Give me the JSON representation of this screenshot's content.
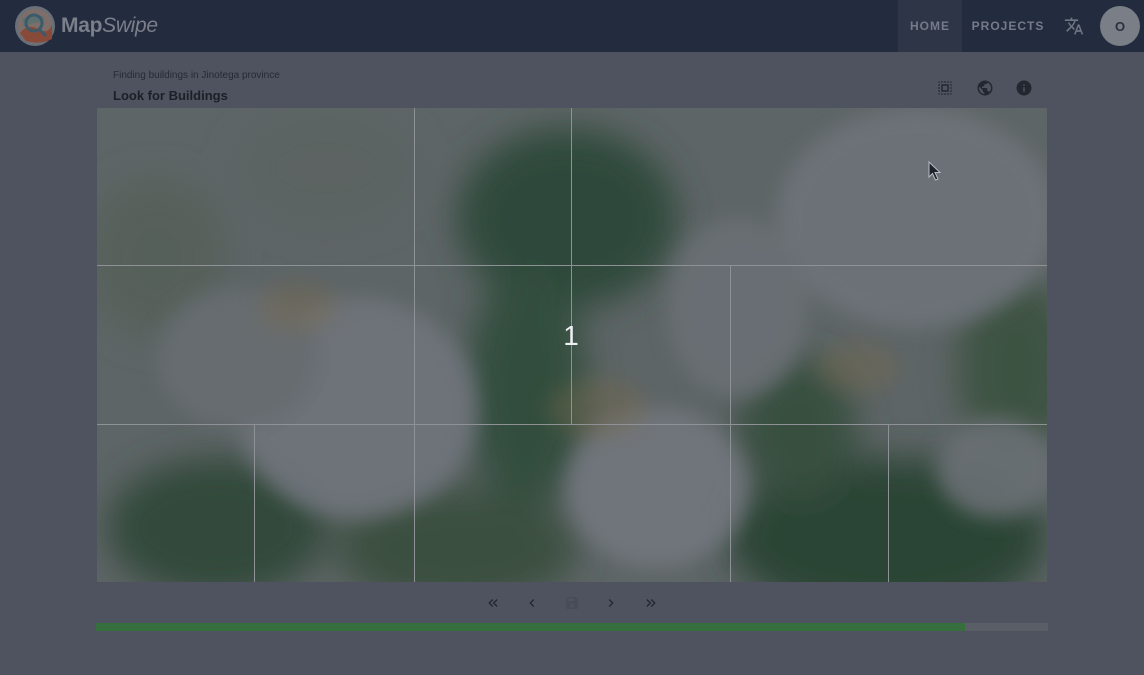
{
  "app": {
    "brand_bold": "Map",
    "brand_italic": "Swipe"
  },
  "nav": {
    "home_label": "HOME",
    "projects_label": "PROJECTS",
    "language_icon": "translate-icon",
    "avatar_initial": "O"
  },
  "project": {
    "subtitle": "Finding buildings in Jinotega province",
    "title": "Look for Buildings"
  },
  "toolbar_icons": [
    "select-all-icon",
    "globe-icon",
    "info-icon"
  ],
  "map": {
    "tile_number": "1"
  },
  "paging": {
    "icons": [
      "first-page-icon",
      "previous-icon",
      "save-icon",
      "next-icon",
      "last-page-icon"
    ]
  },
  "progress": {
    "fraction": 0.913
  },
  "colors": {
    "navbar": "#232b3e",
    "overlay_background": "#4f5360",
    "progress_fill": "#376e3e"
  }
}
